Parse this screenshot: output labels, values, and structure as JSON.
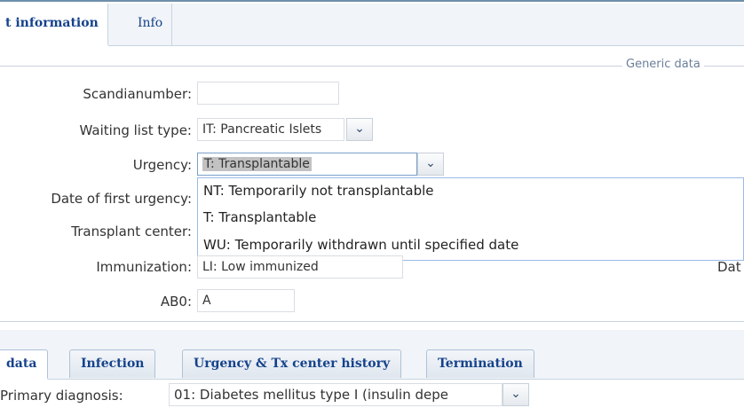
{
  "top_tabs": [
    {
      "label": "t information",
      "active": true
    },
    {
      "label": "Info",
      "active": false
    }
  ],
  "generic_data": {
    "legend": "Generic data",
    "scandianumber": {
      "label": "Scandianumber:",
      "value": ""
    },
    "waiting_list_type": {
      "label": "Waiting list type:",
      "value": "IT: Pancreatic Islets"
    },
    "urgency": {
      "label": "Urgency:",
      "value": "T: Transplantable"
    },
    "date_first_urgency": {
      "label": "Date of first urgency:"
    },
    "transplant_center": {
      "label": "Transplant center:"
    },
    "immunization": {
      "label": "Immunization:",
      "value": "LI: Low immunized"
    },
    "right_cut_label": "Dat",
    "ab0": {
      "label": "AB0:",
      "value": "A"
    }
  },
  "urgency_options": [
    "NT: Temporarily not transplantable",
    "T: Transplantable",
    "WU: Temporarily withdrawn until specified date"
  ],
  "bottom_tabs": [
    {
      "label": "data",
      "active": true
    },
    {
      "label": "Infection",
      "active": false
    },
    {
      "label": "Urgency & Tx center history",
      "active": false
    },
    {
      "label": "Termination",
      "active": false
    }
  ],
  "primary_diagnosis": {
    "label": "Primary diagnosis:",
    "value": "01: Diabetes mellitus type I (insulin depe"
  },
  "icons": {
    "dropdown_arrow": "chevron-down-icon"
  },
  "colors": {
    "tab_text": "#15428b",
    "border": "#99bbe8",
    "legend": "#6a7f9a"
  }
}
